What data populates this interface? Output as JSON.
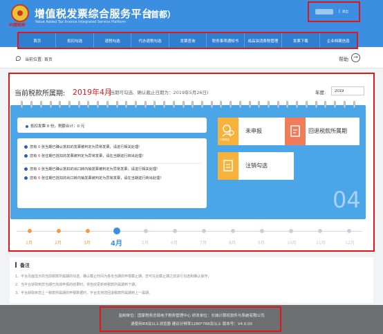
{
  "header": {
    "logo_script": "中国税务",
    "title": "增值税发票综合服务平台",
    "title_en": "Value Added Tax Invoice Integrated Service Platform",
    "region": "（首都）",
    "user_sep": "|",
    "logout_label": "退出"
  },
  "nav": {
    "items": [
      {
        "label": "首页"
      },
      {
        "label": "抵扣勾选"
      },
      {
        "label": "退税勾选"
      },
      {
        "label": "代办退税勾选"
      },
      {
        "label": "发票查询"
      },
      {
        "label": "税务事项通知书"
      },
      {
        "label": "成品油消费税管理"
      },
      {
        "label": "发票下载"
      },
      {
        "label": "企业档案信息"
      }
    ]
  },
  "location": {
    "text": "当前位置: 首页",
    "help_label": "帮助",
    "help_icon": "arrow-right-circle-icon"
  },
  "main": {
    "period_label": "当前税款所属期:",
    "period_value": "2019年4月",
    "period_note": "(当期可勾选、确认截止日期为：2019年5月26日)",
    "year_label": "年度:",
    "year_value": "2019",
    "invoice_summary": "抵扣发票 0 份，税额合计：0 元",
    "notices": [
      {
        "prefix": "您有 ",
        "num": "0",
        "text": " 张当期已确认抵扣的发票被判定为异常发票，请进行相关处理!"
      },
      {
        "prefix": "您有 ",
        "num": "0",
        "text": " 张往期已抵扣的发票被判定为异常发票，请在当期进行转出处理!"
      },
      {
        "prefix": "您有 ",
        "num": "0",
        "text": " 张当期已确认抵扣的出口转内销发票被判定为异常发票，请进行相关处理!"
      },
      {
        "prefix": "您有 ",
        "num": "0",
        "text": " 张往期已抵扣的出口转内销发票被判定为异常发票，请在当期进行转出处理!"
      }
    ],
    "tiles": [
      {
        "label": "未申报",
        "sub": "申报状态",
        "color": "#f7b23b"
      },
      {
        "label": "回退税款所属期",
        "sub": "",
        "color": "#f07c5a"
      },
      {
        "label": "注销勾选",
        "sub": "",
        "color": "#f7b23b"
      }
    ],
    "big_number": "04",
    "months": [
      {
        "label": "1月",
        "state": "done"
      },
      {
        "label": "2月",
        "state": "done"
      },
      {
        "label": "3月",
        "state": "done"
      },
      {
        "label": "4月",
        "state": "current"
      },
      {
        "label": "5月",
        "state": "future"
      },
      {
        "label": "6月",
        "state": "future"
      },
      {
        "label": "7月",
        "state": "future"
      },
      {
        "label": "8月",
        "state": "future"
      },
      {
        "label": "9月",
        "state": "future"
      },
      {
        "label": "10月",
        "state": "future"
      },
      {
        "label": "11月",
        "state": "future"
      },
      {
        "label": "12月",
        "state": "future"
      }
    ]
  },
  "notes": {
    "title": "备注",
    "lines": [
      "1、平台页面显示的当前税款所属期的勾选、确认截止时间为各省当期的申报截止期，您可在此截止期之前进行勾选和确认操作；",
      "2、当平台获取到您当期已完成申报的结果时，将自动更新到税款所属期到下期；",
      "3、平台获取到您上一税款所属期的申报数据时，平台支持您回退税款所属期到上一属期。"
    ]
  },
  "footer": {
    "line1": "监制单位：国家税务总局电子税务管理中心    研发单位：长城计算机软件与系统有限公司",
    "line2": "请使用IE8及以上浏览器    建议分辨率1280*768及以上    版本号：V4.0.00"
  },
  "colors": {
    "header_blue": "#3c8fe0",
    "calendar_blue": "#4ba6e8",
    "highlight_red": "#e0161b",
    "done_orange": "#f39b3a"
  }
}
